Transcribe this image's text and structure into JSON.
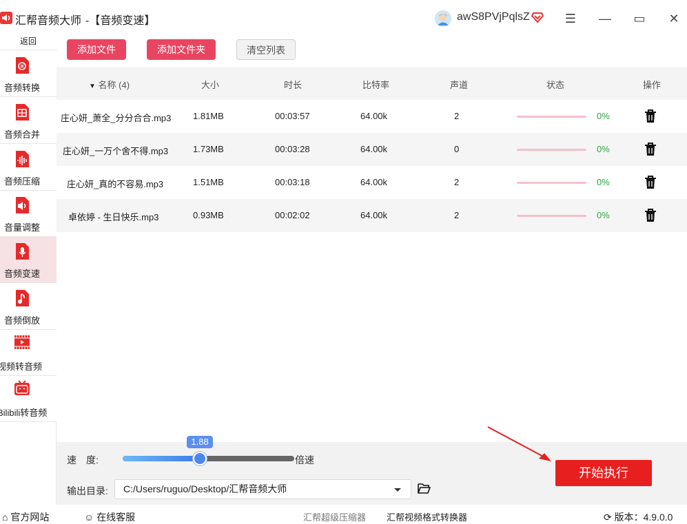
{
  "app": {
    "title": "汇帮音频大师",
    "subtitle": "-【音频变速】",
    "username": "awS8PVjPqlsZ"
  },
  "window": {
    "menu_glyph": "☰",
    "minimize_glyph": "—",
    "maximize_glyph": "▭",
    "close_glyph": "✕"
  },
  "sidebar": {
    "back_label": "返回",
    "items": [
      {
        "label": "音频转换",
        "icon": "audio-convert-icon"
      },
      {
        "label": "音频合并",
        "icon": "audio-merge-icon"
      },
      {
        "label": "音频压缩",
        "icon": "audio-compress-icon"
      },
      {
        "label": "音量调整",
        "icon": "volume-icon"
      },
      {
        "label": "音频变速",
        "icon": "microphone-icon"
      },
      {
        "label": "音频倒放",
        "icon": "music-note-icon"
      },
      {
        "label": "视频转音频",
        "icon": "video-icon"
      },
      {
        "label": "Bilibili转音频",
        "icon": "tv-icon"
      }
    ],
    "active_index": 4
  },
  "toolbar": {
    "add_file": "添加文件",
    "add_folder": "添加文件夹",
    "clear_list": "清空列表"
  },
  "table": {
    "headers": {
      "name": "名称 (4)",
      "size": "大小",
      "duration": "时长",
      "bitrate": "比特率",
      "channels": "声道",
      "status": "状态",
      "action": "操作"
    },
    "rows": [
      {
        "name": "庄心妍_萧全_分分合合.mp3",
        "size": "1.81MB",
        "duration": "00:03:57",
        "bitrate": "64.00k",
        "channels": "2",
        "progress": "0%"
      },
      {
        "name": "庄心妍_一万个舍不得.mp3",
        "size": "1.73MB",
        "duration": "00:03:28",
        "bitrate": "64.00k",
        "channels": "0",
        "progress": "0%"
      },
      {
        "name": "庄心妍_真的不容易.mp3",
        "size": "1.51MB",
        "duration": "00:03:18",
        "bitrate": "64.00k",
        "channels": "2",
        "progress": "0%"
      },
      {
        "name": "卓依婷 - 生日快乐.mp3",
        "size": "0.93MB",
        "duration": "00:02:02",
        "bitrate": "64.00k",
        "channels": "2",
        "progress": "0%"
      }
    ]
  },
  "speed": {
    "label": "速　度:",
    "value": "1.88",
    "slider_fraction": 0.45,
    "unit": "倍速"
  },
  "output": {
    "label": "输出目录:",
    "path": "C:/Users/ruguo/Desktop/汇帮音频大师"
  },
  "start_button": "开始执行",
  "statusbar": {
    "website": "官方网站",
    "support": "在线客服",
    "link1": "汇帮超级压缩器",
    "link2": "汇帮视频格式转换器",
    "version": "版本：4.9.0.0"
  },
  "colors": {
    "accent": "#e94561",
    "start": "#e81f1f",
    "progress_text": "#28a745",
    "slider": "#4d86ee"
  }
}
